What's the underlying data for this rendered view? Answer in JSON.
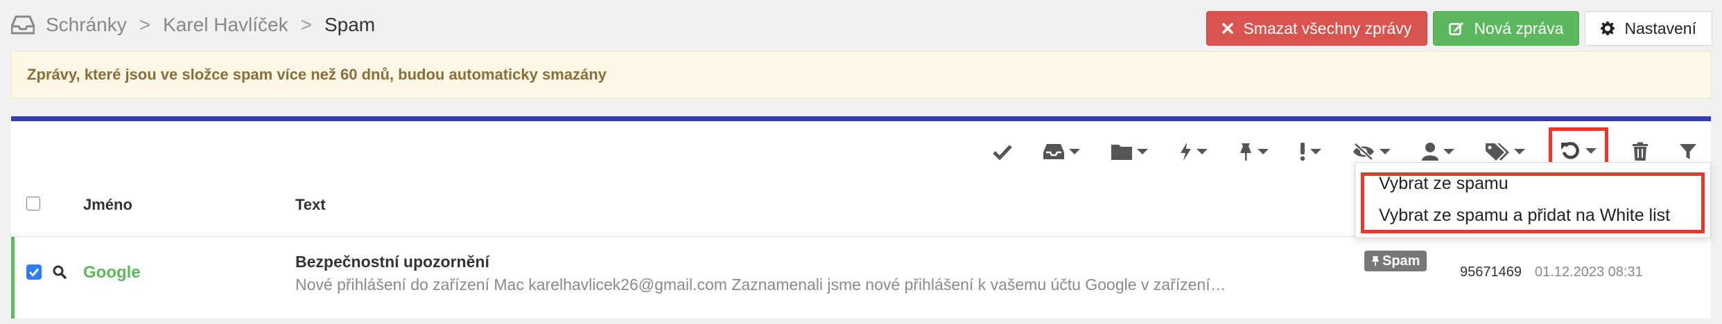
{
  "breadcrumb": {
    "icon": "inbox-icon",
    "items": [
      "Schránky",
      "Karel Havlíček"
    ],
    "separator": ">",
    "current": "Spam"
  },
  "header_actions": {
    "delete_all": {
      "label": "Smazat všechny zprávy",
      "icon": "close-icon",
      "color": "#d9534f"
    },
    "new_message": {
      "label": "Nová zpráva",
      "icon": "edit-icon",
      "color": "#5cb85c"
    },
    "settings": {
      "label": "Nastavení",
      "icon": "gear-icon"
    }
  },
  "banner": {
    "text": "Zprávy, které jsou ve složce spam více než 60 dnů, budou automaticky smazány"
  },
  "toolbar": {
    "items": [
      "check-icon",
      "inbox-icon",
      "folder-icon",
      "bolt-icon",
      "pin-icon",
      "exclamation-icon",
      "eye-slash-icon",
      "user-icon",
      "tags-icon",
      "undo-icon",
      "trash-icon",
      "filter-icon"
    ],
    "accent_color": "#3539b7"
  },
  "table": {
    "headers": {
      "name": "Jméno",
      "text": "Text"
    },
    "rows": [
      {
        "selected": true,
        "name": "Google",
        "subject": "Bezpečnostní upozornění",
        "preview": "Nové přihlášení do zařízení Mac karelhavlicek26@gmail.com Zaznamenali jsme nové přihlášení k vašemu účtu Google v zařízení…",
        "tag": "Spam",
        "id": "95671469",
        "date": "01.12.2023 08:31"
      }
    ]
  },
  "dropdown": {
    "items": [
      "Vybrat ze spamu",
      "Vybrat ze spamu a přidat na White list"
    ]
  }
}
